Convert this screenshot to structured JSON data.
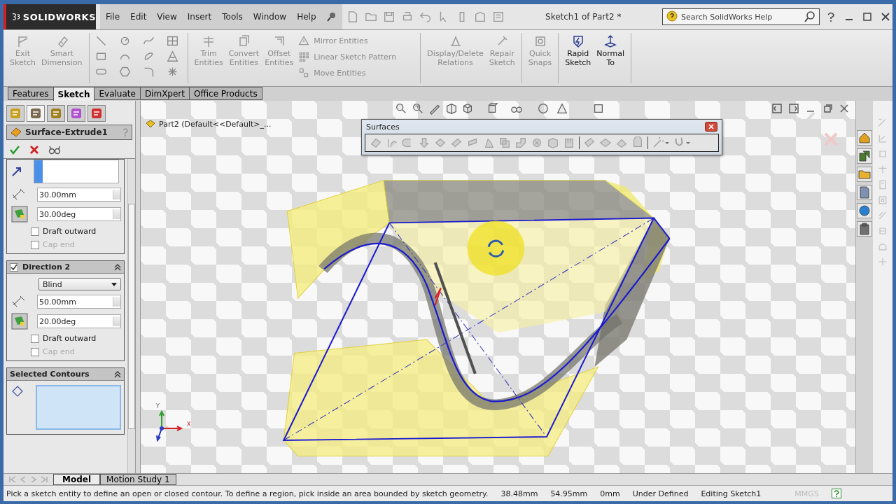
{
  "title_bar": {
    "logo": "SOLIDWORKS",
    "menu": [
      "File",
      "Edit",
      "View",
      "Insert",
      "Tools",
      "Window",
      "Help"
    ],
    "title": "Sketch1 of Part2 *",
    "search_placeholder": "Search SolidWorks Help"
  },
  "command_groups": [
    {
      "items": [
        {
          "label": "Exit Sketch",
          "kind": "large",
          "disabled": true
        },
        {
          "label": "Smart Dimension",
          "kind": "large",
          "disabled": true
        }
      ]
    },
    {
      "items": [
        {
          "label": "Trim Entities",
          "kind": "large",
          "disabled": true
        },
        {
          "label": "Convert Entities",
          "kind": "large",
          "disabled": true
        },
        {
          "label": "Offset Entities",
          "kind": "large",
          "disabled": true
        },
        {
          "label": "Mirror Entities",
          "kind": "small",
          "disabled": true
        },
        {
          "label": "Linear Sketch Pattern",
          "kind": "small",
          "disabled": true
        },
        {
          "label": "Move Entities",
          "kind": "small",
          "disabled": true
        }
      ]
    },
    {
      "items": [
        {
          "label": "Display/Delete Relations",
          "kind": "large",
          "disabled": true
        },
        {
          "label": "Repair Sketch",
          "kind": "large",
          "disabled": true
        }
      ]
    },
    {
      "items": [
        {
          "label": "Quick Snaps",
          "kind": "large",
          "disabled": true
        }
      ]
    },
    {
      "items": [
        {
          "label": "Rapid Sketch",
          "kind": "large",
          "disabled": false
        },
        {
          "label": "Normal To",
          "kind": "large",
          "disabled": false
        }
      ]
    }
  ],
  "tabs": [
    {
      "label": "Features",
      "selected": false
    },
    {
      "label": "Sketch",
      "selected": true
    },
    {
      "label": "Evaluate",
      "selected": false
    },
    {
      "label": "DimXpert",
      "selected": false
    },
    {
      "label": "Office Products",
      "selected": false
    }
  ],
  "tree_path": "Part2  (Default<<Default>_...",
  "property_manager": {
    "title": "Surface-Extrude1",
    "direction1": {
      "depth": "30.00mm",
      "draft": "30.00deg",
      "draft_outward": {
        "label": "Draft outward",
        "checked": false
      },
      "cap_end": {
        "label": "Cap end",
        "checked": false,
        "disabled": true
      }
    },
    "direction2": {
      "title": "Direction 2",
      "checked": true,
      "end_condition": "Blind",
      "depth": "50.00mm",
      "draft": "20.00deg",
      "draft_outward": {
        "label": "Draft outward",
        "checked": false
      },
      "cap_end": {
        "label": "Cap end",
        "checked": false,
        "disabled": true
      }
    },
    "contours": {
      "title": "Selected Contours"
    }
  },
  "surfaces_toolbar": {
    "title": "Surfaces"
  },
  "triad": {
    "y": "Y",
    "x": "X"
  },
  "bottom_tabs": [
    {
      "label": "Model",
      "selected": true
    },
    {
      "label": "Motion Study 1",
      "selected": false
    }
  ],
  "status_bar": {
    "message": "Pick a sketch entity to define an open or closed contour. To define a region, pick inside an area bounded by sketch geometry.",
    "x": "38.48mm",
    "y": "54.95mm",
    "z": "0mm",
    "state": "Under Defined",
    "editing": "Editing Sketch1",
    "units": "MMGS"
  }
}
